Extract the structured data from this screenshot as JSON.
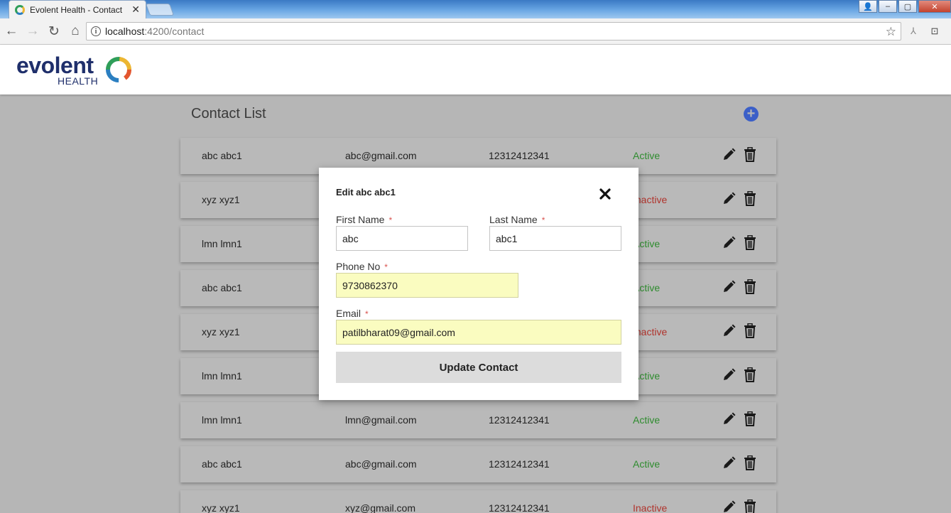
{
  "browser": {
    "tab_title": "Evolent Health - Contact",
    "url_host": "localhost",
    "url_path": ":4200/contact"
  },
  "header": {
    "logo_word": "evolent",
    "logo_sub": "HEALTH"
  },
  "main": {
    "title": "Contact List"
  },
  "contacts": [
    {
      "name": "abc abc1",
      "email": "abc@gmail.com",
      "phone": "12312412341",
      "status": "Active"
    },
    {
      "name": "xyz xyz1",
      "email": "",
      "phone": "",
      "status": "Inactive"
    },
    {
      "name": "lmn lmn1",
      "email": "",
      "phone": "",
      "status": "Active"
    },
    {
      "name": "abc abc1",
      "email": "",
      "phone": "",
      "status": "Active"
    },
    {
      "name": "xyz xyz1",
      "email": "",
      "phone": "",
      "status": "Inactive"
    },
    {
      "name": "lmn lmn1",
      "email": "",
      "phone": "",
      "status": "Active"
    },
    {
      "name": "lmn lmn1",
      "email": "lmn@gmail.com",
      "phone": "12312412341",
      "status": "Active"
    },
    {
      "name": "abc abc1",
      "email": "abc@gmail.com",
      "phone": "12312412341",
      "status": "Active"
    },
    {
      "name": "xyz xyz1",
      "email": "xyz@gmail.com",
      "phone": "12312412341",
      "status": "Inactive"
    }
  ],
  "modal": {
    "title": "Edit abc abc1",
    "first_name_label": "First Name",
    "first_name_value": "abc",
    "last_name_label": "Last Name",
    "last_name_value": "abc1",
    "phone_label": "Phone No",
    "phone_value": "9730862370",
    "email_label": "Email",
    "email_value": "patilbharat09@gmail.com",
    "required_mark": "*",
    "submit_label": "Update Contact"
  },
  "colors": {
    "active": "#2e8c2e",
    "inactive": "#b0332c",
    "accent": "#3b5fc8"
  }
}
